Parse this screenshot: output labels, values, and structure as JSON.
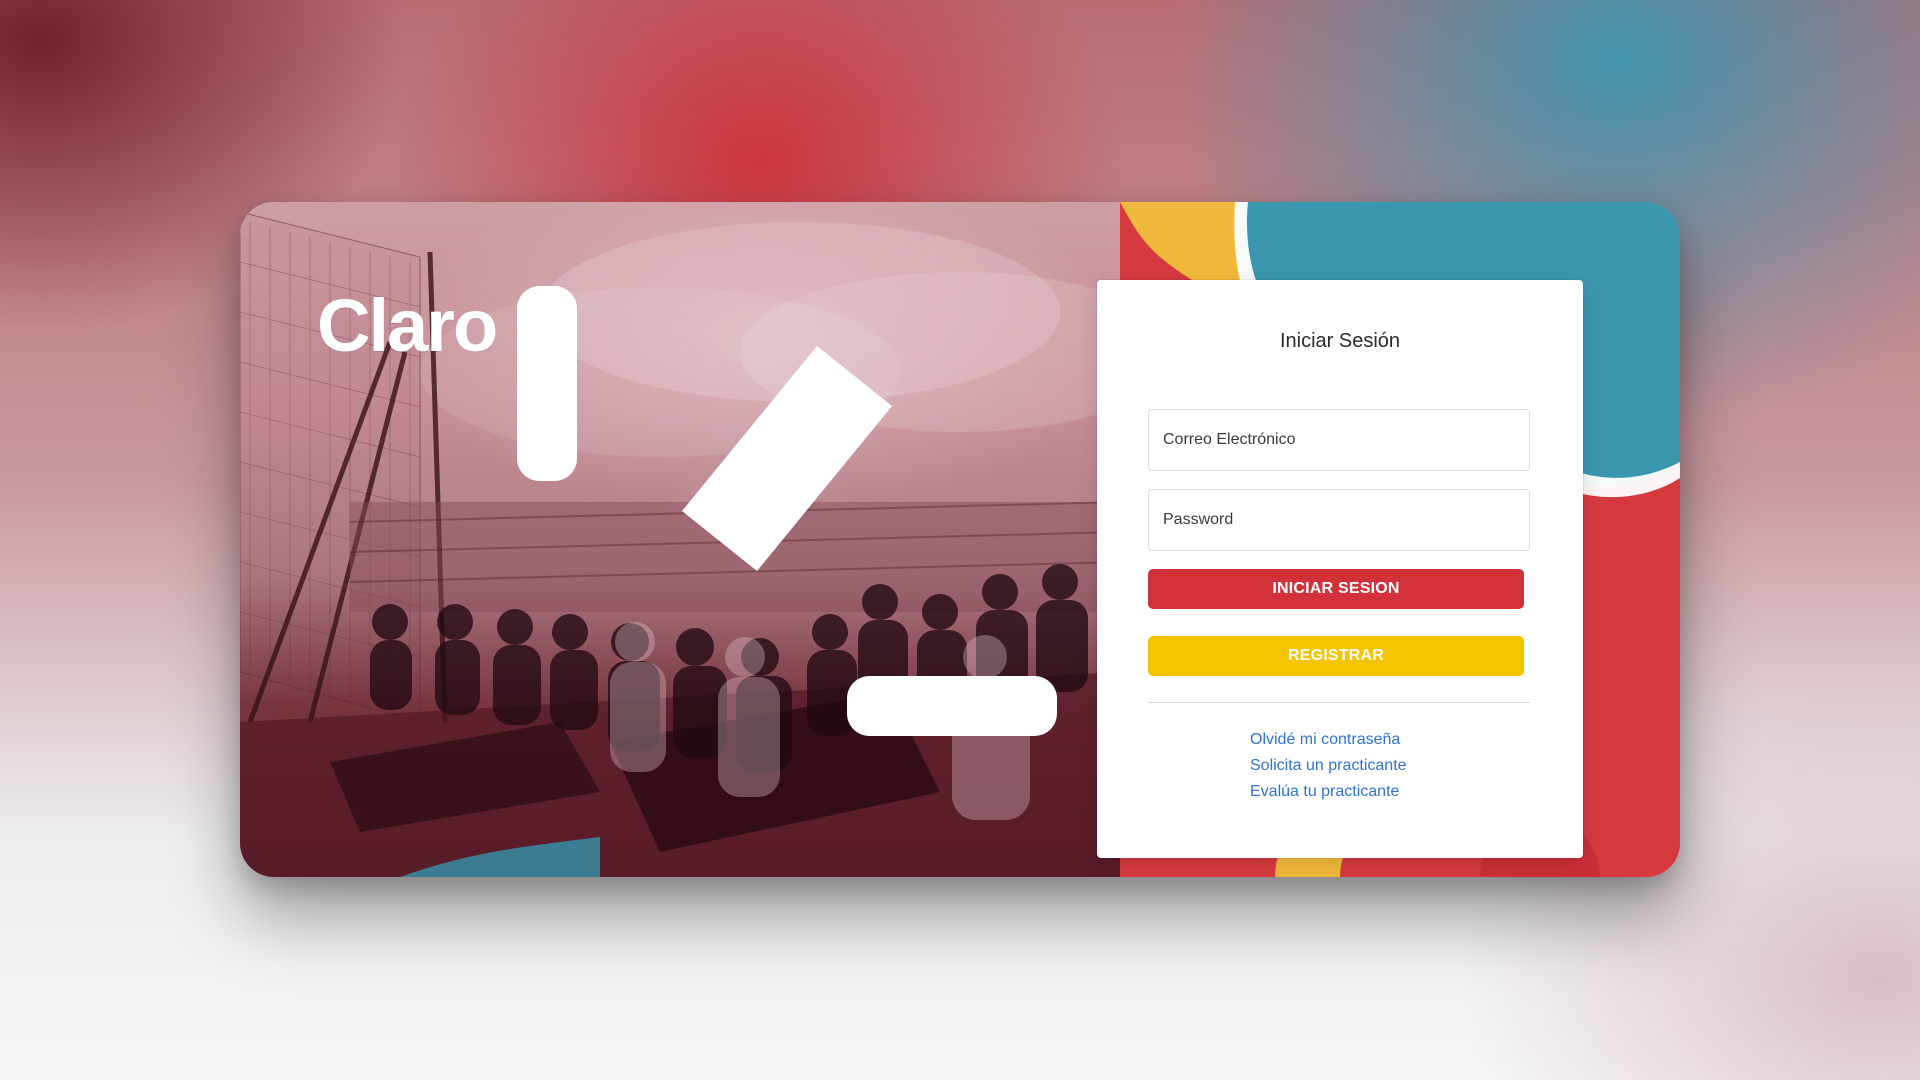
{
  "brand": {
    "name": "Claro"
  },
  "login": {
    "title": "Iniciar Sesión",
    "email_placeholder": "Correo Electrónico",
    "password_placeholder": "Password",
    "login_button": "INICIAR SESION",
    "register_button": "REGISTRAR",
    "links": [
      "Olvidé mi contraseña",
      "Solicita un practicante",
      "Evalúa tu practicante"
    ]
  },
  "colors": {
    "primary_red": "#d3313a",
    "primary_yellow": "#f5c400",
    "accent_teal": "#3b97ad",
    "link_blue": "#2f74d0"
  }
}
